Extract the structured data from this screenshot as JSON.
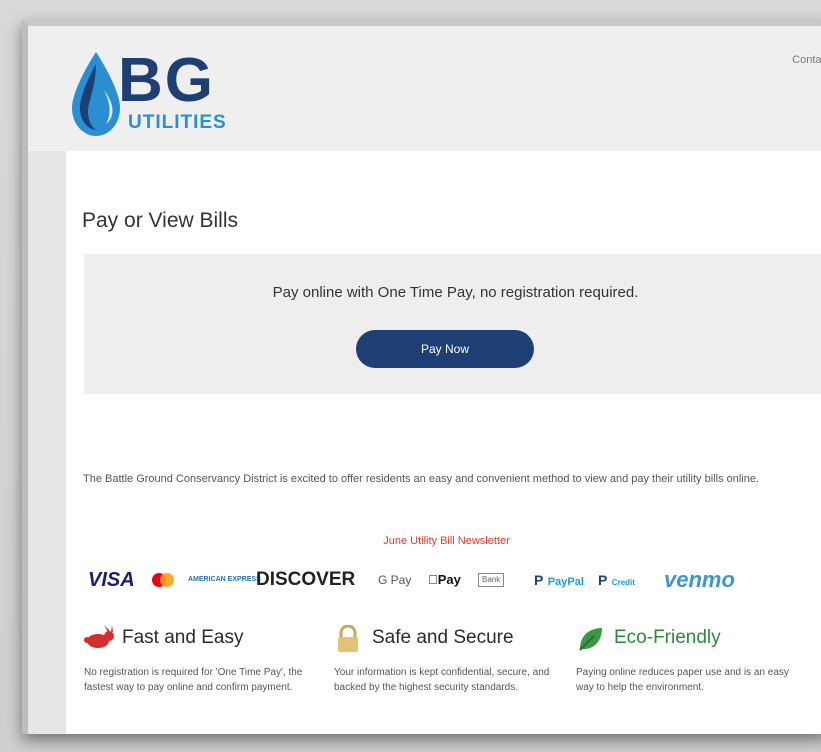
{
  "header": {
    "logo_text": "BG",
    "logo_subtext": "UTILITIES",
    "contact_link": "Contac"
  },
  "main": {
    "title": "Pay or View Bills",
    "pay_prompt": "Pay online with One Time Pay, no registration required.",
    "pay_button": "Pay Now",
    "intro": "The Battle Ground Conservancy District is excited to offer residents an easy and convenient method to view and pay their utility bills online.",
    "newsletter_link": "June Utility Bill Newsletter"
  },
  "payment_methods": [
    {
      "name": "visa-icon",
      "label": "VISA"
    },
    {
      "name": "mastercard-icon",
      "label": ""
    },
    {
      "name": "amex-icon",
      "label": "AMERICAN EXPRESS"
    },
    {
      "name": "discover-icon",
      "label": "DISCOVER"
    },
    {
      "name": "google-pay-icon",
      "label": "G Pay"
    },
    {
      "name": "apple-pay-icon",
      "label": "Pay"
    },
    {
      "name": "bank-icon",
      "label": "Bank"
    },
    {
      "name": "paypal-icon",
      "label": "PayPal"
    },
    {
      "name": "paypal-credit-icon",
      "label": "Credit"
    },
    {
      "name": "venmo-icon",
      "label": "venmo"
    }
  ],
  "features": [
    {
      "title": "Fast and Easy",
      "icon": "rabbit-icon",
      "body": "No registration is required for 'One Time Pay', the fastest way to pay online and confirm payment."
    },
    {
      "title": "Safe and Secure",
      "icon": "lock-icon",
      "body": "Your information is kept confidential, secure, and backed by the highest security standards."
    },
    {
      "title": "Eco-Friendly",
      "icon": "leaf-icon",
      "body": "Paying online reduces paper use and is an easy way to help the environment."
    }
  ],
  "colors": {
    "brand_navy": "#1d3f73",
    "brand_blue": "#2a8fd0",
    "newsletter_red": "#e53a2f",
    "eco_green": "#2c8a3a"
  }
}
